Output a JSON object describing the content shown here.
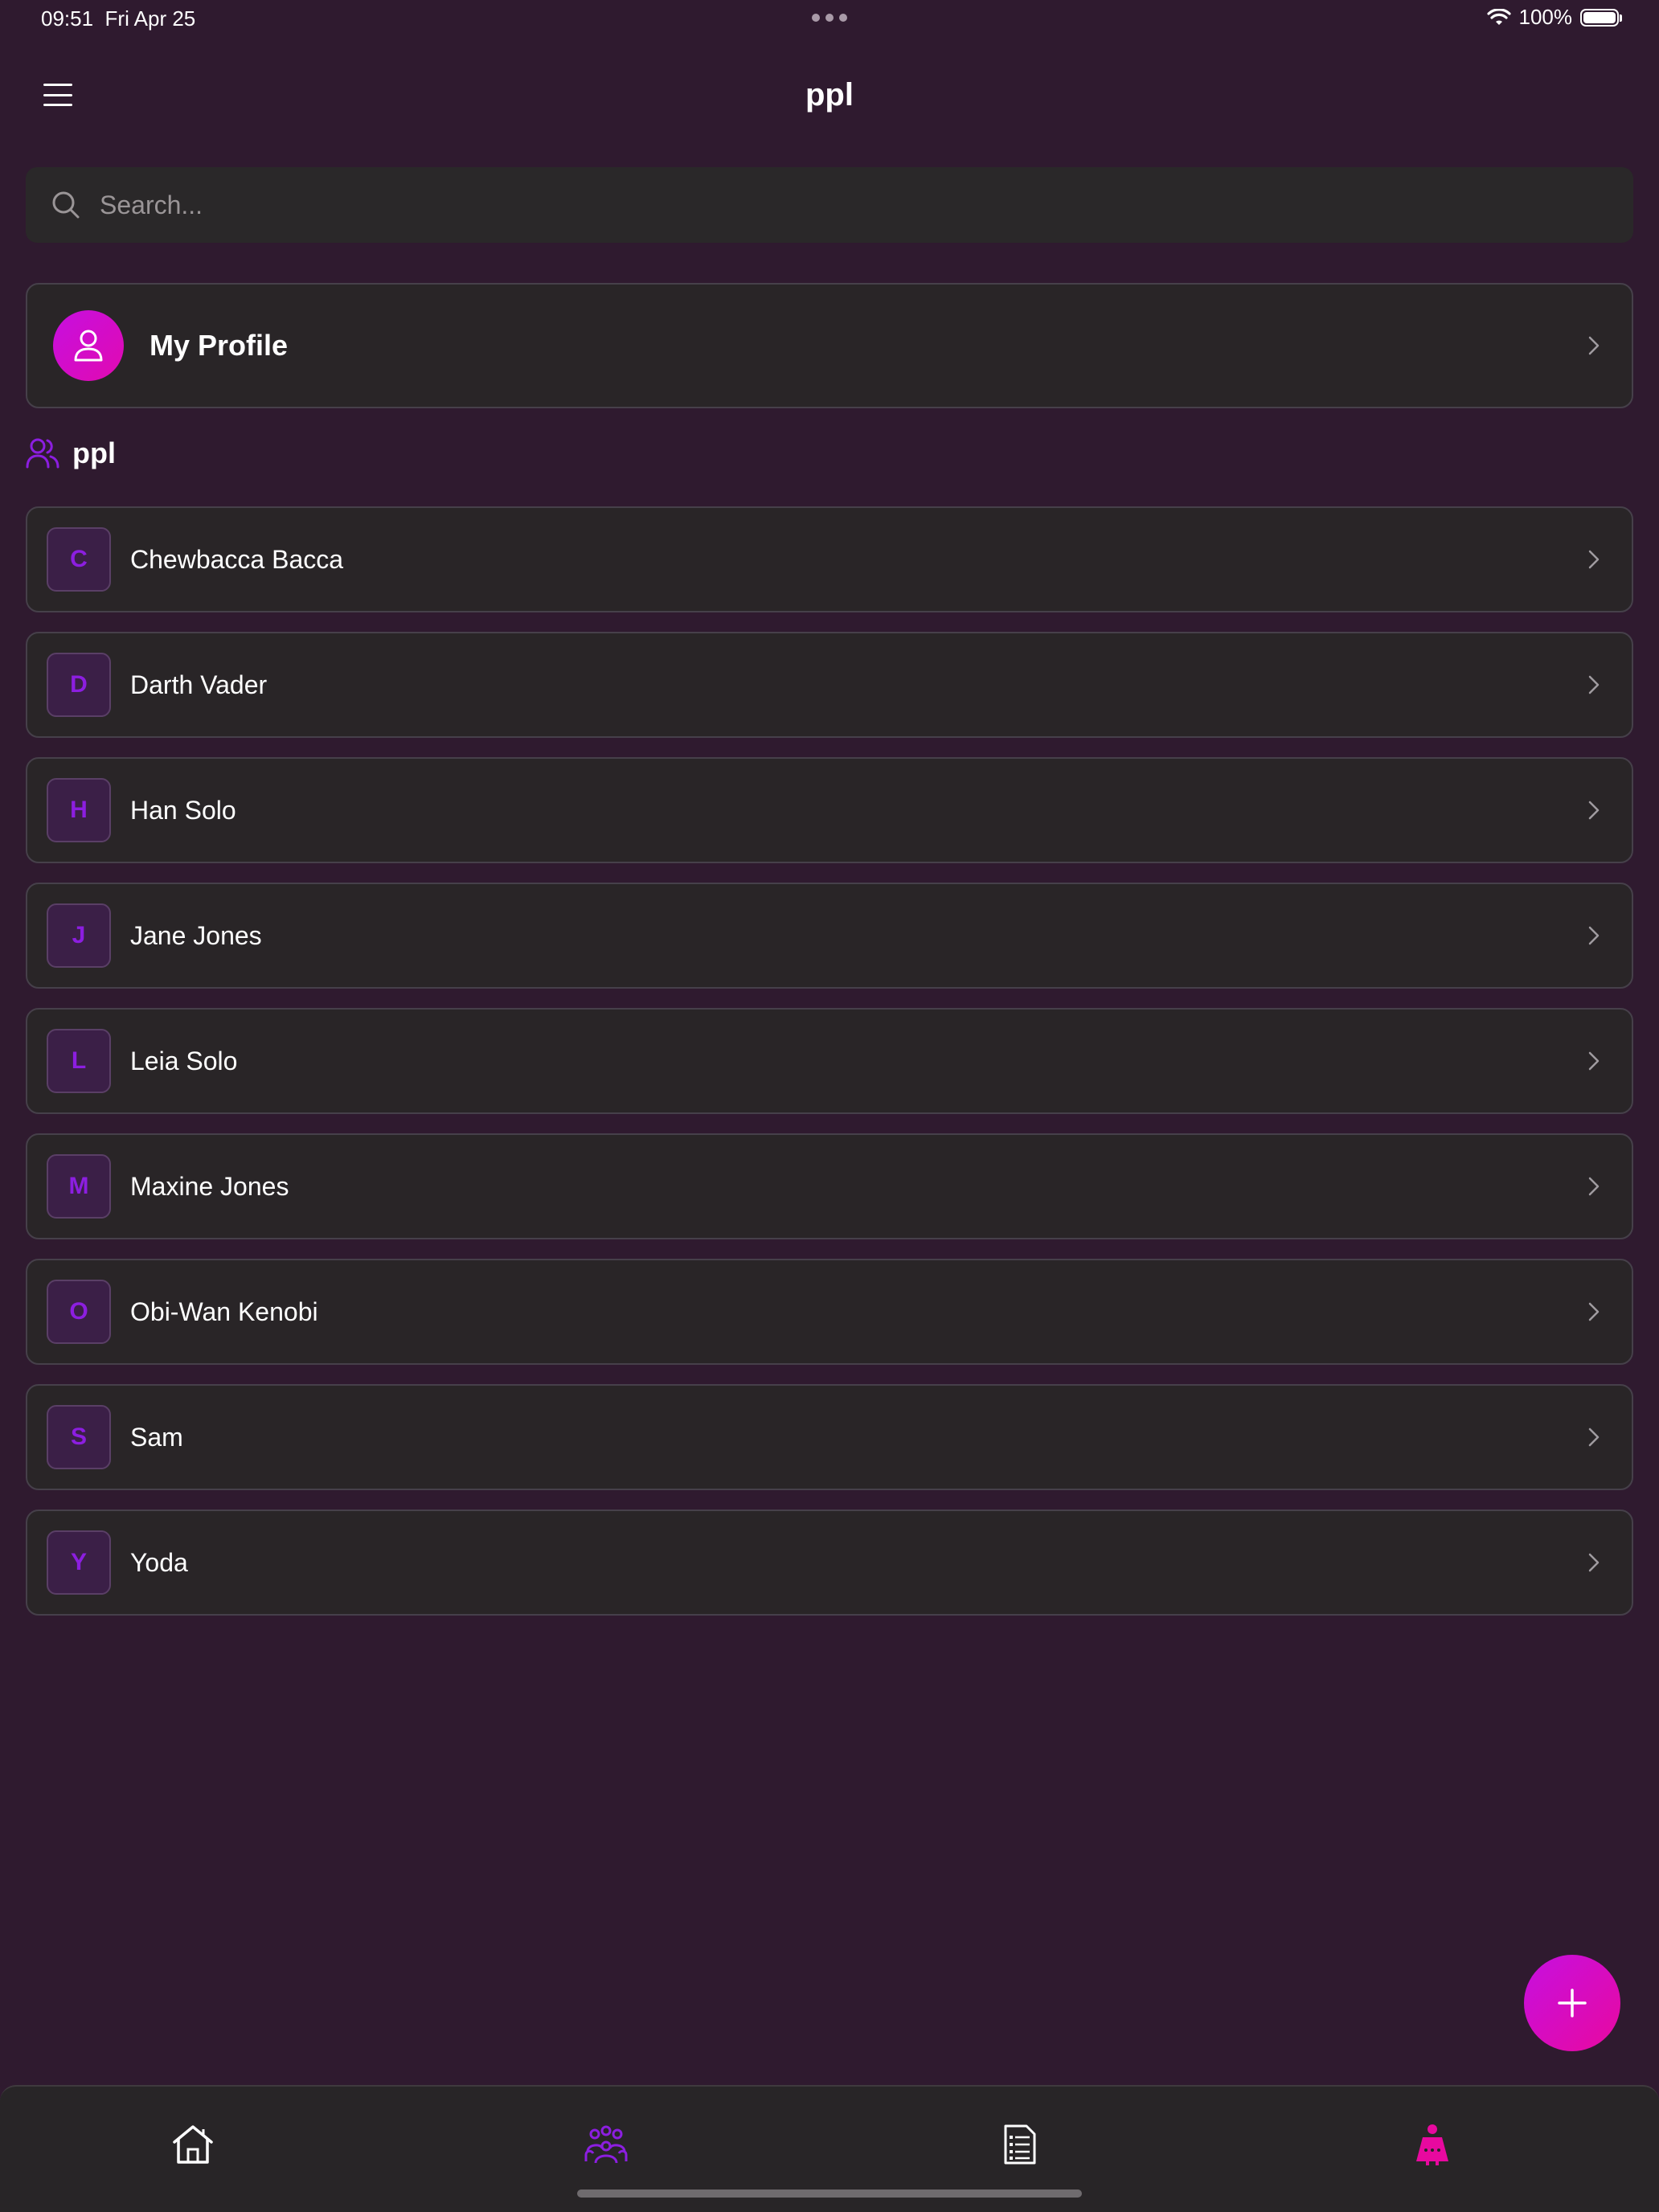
{
  "status_bar": {
    "time": "09:51",
    "date": "Fri Apr 25",
    "battery": "100%",
    "battery_level": 1.0,
    "icons": [
      "wifi-icon",
      "battery-icon",
      "multitasking-dots-icon"
    ]
  },
  "header": {
    "title": "ppl",
    "menu_icon": "hamburger-menu-icon"
  },
  "search": {
    "placeholder": "Search...",
    "value": "",
    "icon": "search-icon"
  },
  "profile": {
    "label": "My Profile",
    "icon": "person-icon"
  },
  "section": {
    "title": "ppl",
    "icon": "people-group-icon"
  },
  "people": [
    {
      "initial": "C",
      "name": "Chewbacca Bacca"
    },
    {
      "initial": "D",
      "name": "Darth Vader"
    },
    {
      "initial": "H",
      "name": "Han Solo"
    },
    {
      "initial": "J",
      "name": "Jane Jones"
    },
    {
      "initial": "L",
      "name": "Leia Solo"
    },
    {
      "initial": "M",
      "name": "Maxine Jones"
    },
    {
      "initial": "O",
      "name": "Obi-Wan Kenobi"
    },
    {
      "initial": "S",
      "name": "Sam"
    },
    {
      "initial": "Y",
      "name": "Yoda"
    }
  ],
  "fab": {
    "icon": "plus-icon"
  },
  "tab_bar": {
    "tabs": [
      {
        "icon": "home-icon",
        "active": false
      },
      {
        "icon": "people-group-icon",
        "active": true
      },
      {
        "icon": "document-list-icon",
        "active": false
      },
      {
        "icon": "person-chat-icon",
        "active": false
      }
    ]
  },
  "colors": {
    "background": "#2f1a2f",
    "card": "#292527",
    "card_border": "#46404a",
    "accent_purple": "#8c1ee0",
    "accent_magenta": "#e10ab0"
  }
}
